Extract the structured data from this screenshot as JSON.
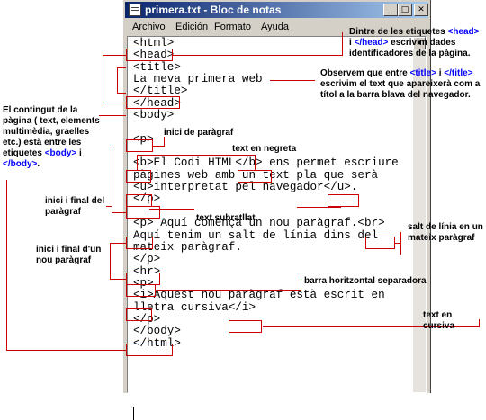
{
  "window": {
    "title": "primera.txt - Bloc de notas",
    "controls": {
      "minimize": "_",
      "maximize": "□",
      "close": "✕"
    }
  },
  "menu": [
    "Archivo",
    "Edición",
    "Formato",
    "Ayuda"
  ],
  "code_lines": [
    "<html>",
    "<head>",
    "<title>",
    "La meva primera web",
    "</title>",
    "</head>",
    "<body>",
    "",
    "<p>",
    "",
    "<b>El Codi HTML</b> ens permet escriure",
    "pàgines web amb un text pla que serà",
    "<u>interpretat pel navegador</u>.",
    "</p>",
    "",
    "<p> Aquí comença un nou paràgraf.<br>",
    "Aquí tenim un salt de línia dins del",
    "mateix paràgraf.",
    "</p>",
    "<hr>",
    "<p>",
    "<i>Aquest nou paràgraf està escrit en",
    "lletra cursiva</i>",
    "</p>",
    "</body>",
    "</html>"
  ],
  "annotations": {
    "head": {
      "t1": "Dintre de les etiquetes ",
      "tag1": "<head>",
      "t2": " i ",
      "tag2": "</head>",
      "t3": " escrivim dades identificadores de la pàgina."
    },
    "title": {
      "t1": "Observem que entre ",
      "tag1": "<title>",
      "t2": " i ",
      "tag2": "</title>",
      "t3": " escrivim el text que apareixerà com a títol a la barra blava del navegador."
    },
    "body": {
      "t1": "El contingut de la pàgina ( text, elements multimèdia, graelles etc.) està entre les etiquetes ",
      "tag1": "<body>",
      "t2": " i ",
      "tag2": "</body>",
      "t3": "."
    },
    "p_start": "inici de paràgraf",
    "bold": "text en negreta",
    "p_range1": "inici i final del paràgraf",
    "underline": "text  subratllat",
    "br": "salt de línia en un mateix paràgraf",
    "p_range2": "inici i final d'un nou paràgraf",
    "hr": "barra horitzontal separadora",
    "italic": "text en cursiva"
  }
}
